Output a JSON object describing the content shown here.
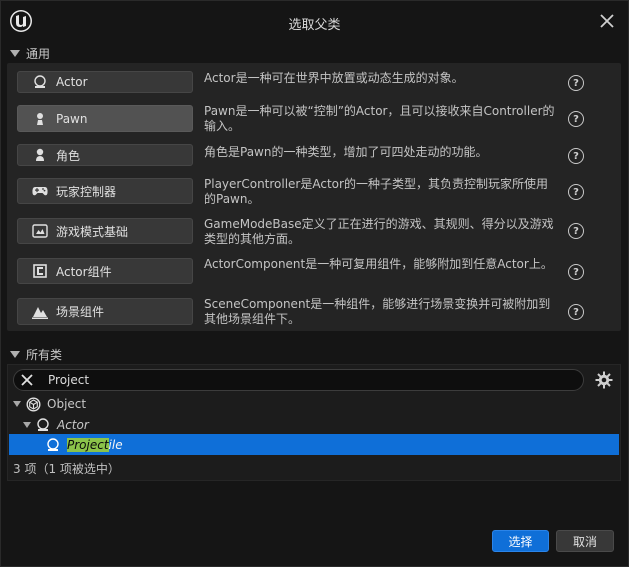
{
  "window": {
    "title": "选取父类",
    "close_icon": "close-icon",
    "logo_icon": "unreal-engine-logo"
  },
  "common": {
    "header": "通用",
    "items": [
      {
        "label": "Actor",
        "icon": "actor-icon",
        "desc": "Actor是一种可在世界中放置或动态生成的对象。"
      },
      {
        "label": "Pawn",
        "icon": "pawn-icon",
        "desc": "Pawn是一种可以被“控制”的Actor，且可以接收来自Controller的输入。"
      },
      {
        "label": "角色",
        "icon": "character-icon",
        "desc": "角色是Pawn的一种类型，增加了可四处走动的功能。"
      },
      {
        "label": "玩家控制器",
        "icon": "gamepad-icon",
        "desc": "PlayerController是Actor的一种子类型，其负责控制玩家所使用的Pawn。"
      },
      {
        "label": "游戏模式基础",
        "icon": "gamemode-icon",
        "desc": "GameModeBase定义了正在进行的游戏、其规则、得分以及游戏类型的其他方面。"
      },
      {
        "label": "Actor组件",
        "icon": "actor-component-icon",
        "desc": "ActorComponent是一种可复用组件，能够附加到任意Actor上。"
      },
      {
        "label": "场景组件",
        "icon": "scene-component-icon",
        "desc": "SceneComponent是一种组件，能够进行场景变换并可被附加到其他场景组件下。"
      }
    ]
  },
  "all_classes": {
    "header": "所有类",
    "search_value": "Project",
    "tree": {
      "root": "Object",
      "child": "Actor",
      "leaf_match": "Project",
      "leaf_rest": "ile"
    },
    "count_text": "3 项（1 项被选中）"
  },
  "footer": {
    "select_label": "选择",
    "cancel_label": "取消"
  },
  "colors": {
    "accent": "#0f6fd8",
    "highlight": "#8bc34a"
  }
}
